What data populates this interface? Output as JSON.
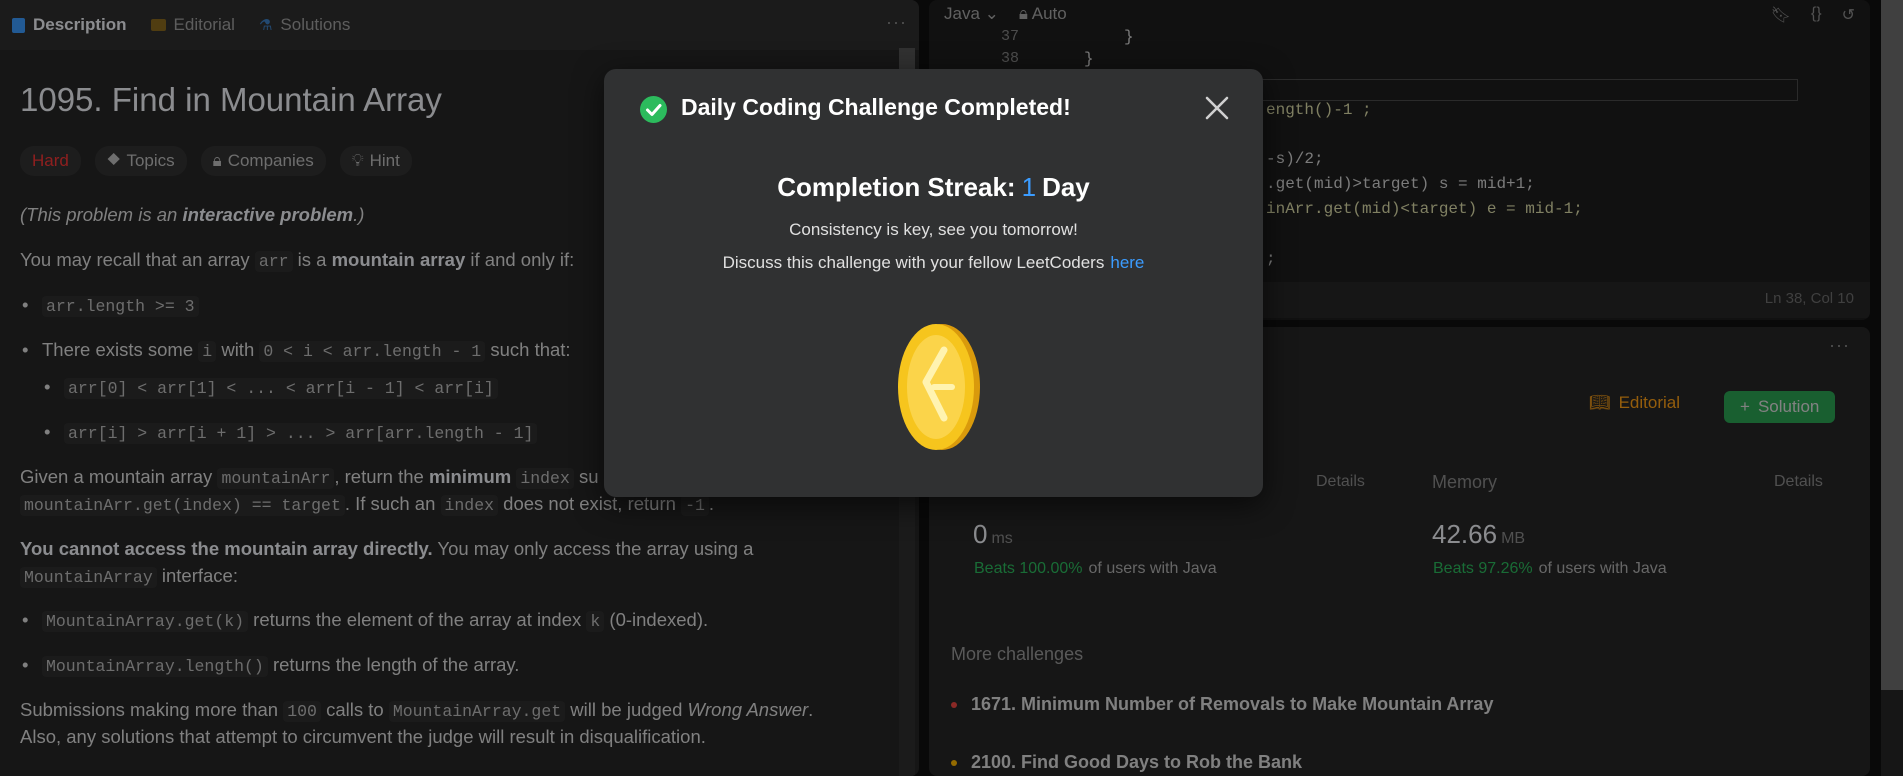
{
  "left": {
    "tabs": [
      {
        "label": "Description",
        "icon": "description-icon",
        "color": "#3b9cff"
      },
      {
        "label": "Editorial",
        "icon": "book-icon",
        "color": "#ffc01e"
      },
      {
        "label": "Solutions",
        "icon": "flask-icon",
        "color": "#3b9cff"
      }
    ],
    "more": "···",
    "title": "1095. Find in Mountain Array",
    "tags": {
      "difficulty": "Hard",
      "topics": "Topics",
      "companies": "Companies",
      "hint": "Hint"
    },
    "intro": {
      "pre": "(This problem is an ",
      "bold": "interactive problem",
      "post": ".)"
    },
    "recall": {
      "pre": "You may recall that an array ",
      "code": "arr",
      "mid": " is a ",
      "bold": "mountain array",
      "post": " if and only if:"
    },
    "bullet1": "arr.length >= 3",
    "bullet2": {
      "pre": "There exists some ",
      "code1": "i",
      "mid": " with ",
      "code2": "0 < i < arr.length - 1",
      "post": " such that:"
    },
    "sub1": "arr[0] < arr[1] < ... < arr[i - 1] < arr[i]",
    "sub2": "arr[i] > arr[i + 1] > ... > arr[arr.length - 1]",
    "given": {
      "pre": "Given a mountain array ",
      "code1": "mountainArr",
      "mid": ", return the ",
      "bold": "minimum",
      "code2": "index",
      "tail": " su",
      "code3": "mountainArr.get(index) == target",
      "post": ". If such an ",
      "code4": "index",
      "post2": " does not exist, return ",
      "code5": "-1",
      "end": "."
    },
    "cannot": {
      "bold": "You cannot access the mountain array directly.",
      "post": " You may only access the array using a ",
      "code": "MountainArray",
      "end": " interface:"
    },
    "api1": {
      "code": "MountainArray.get(k)",
      "mid": " returns the element of the array at index ",
      "code2": "k",
      "post": " (0-indexed)."
    },
    "api2": {
      "code": "MountainArray.length()",
      "post": " returns the length of the array."
    },
    "subm": {
      "pre": "Submissions making more than ",
      "code1": "100",
      "mid": " calls to ",
      "code2": "MountainArray.get",
      "mid2": " will be judged ",
      "it": "Wrong Answer",
      "post": "."
    },
    "also": "Also, any solutions that attempt to circumvent the judge will result in disqualification."
  },
  "code": {
    "lang": "Java",
    "auto": "Auto",
    "line37": "37",
    "line38": "38",
    "frag37": "}",
    "frag38": "}",
    "frag_len": "ength()-1 ;",
    "frag_mid": "-s)/2;",
    "frag_get1": ".get(mid)>target) s = mid+1;",
    "frag_get2": "inArr.get(mid)<target) e = mid-1;",
    "frag_semi": ";",
    "status": "Ln 38, Col 10"
  },
  "result": {
    "more": "···",
    "editorial": "Editorial",
    "solution": "Solution",
    "runtime_details": "Details",
    "memory_label": "Memory",
    "memory_details": "Details",
    "runtime_value": "0",
    "runtime_unit": "ms",
    "memory_value": "42.66",
    "memory_unit": "MB",
    "runtime_beats": "Beats 100.00%",
    "memory_beats": "Beats 97.26%",
    "beats_suffix": "of users with Java",
    "more_challenges": "More challenges",
    "challenges": [
      {
        "label": "1671. Minimum Number of Removals to Make Mountain Array",
        "color": "#ef4743"
      },
      {
        "label": "2100. Find Good Days to Rob the Bank",
        "color": "#ffb800"
      }
    ]
  },
  "modal": {
    "title": "Daily Coding Challenge Completed!",
    "streak_label": "Completion Streak:",
    "streak_value": "1",
    "streak_unit": "Day",
    "line1": "Consistency is key, see you tomorrow!",
    "line2": "Discuss this challenge with your fellow LeetCoders",
    "link": "here"
  }
}
